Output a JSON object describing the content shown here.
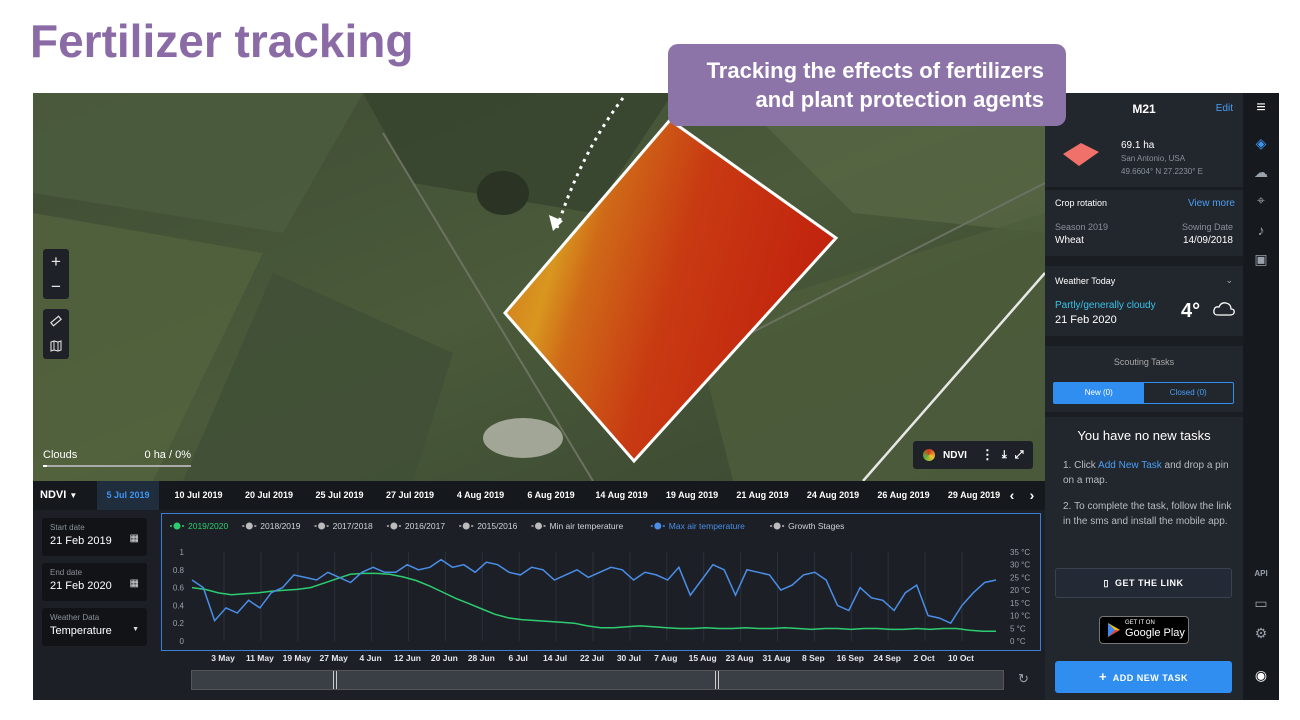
{
  "slide": {
    "title": "Fertilizer tracking",
    "callout_line1": "Tracking the effects of fertilizers",
    "callout_line2": "and plant protection agents"
  },
  "map": {
    "zoom_in": "+",
    "zoom_out": "−",
    "clouds_label": "Clouds",
    "clouds_value": "0 ha / 0%",
    "layer_label": "NDVI"
  },
  "field": {
    "name": "M21",
    "edit": "Edit",
    "area": "69.1 ha",
    "location": "San Antonio, USA",
    "coords": "49.6604° N 27.2230° E",
    "shape_color": "#f0706a"
  },
  "crop": {
    "title": "Crop rotation",
    "view_more": "View more",
    "season_label": "Season 2019",
    "season_value": "Wheat",
    "sowing_label": "Sowing Date",
    "sowing_value": "14/09/2018"
  },
  "weather": {
    "title": "Weather Today",
    "condition": "Partly/generally cloudy",
    "date": "21 Feb 2020",
    "temp": "4°"
  },
  "scouting": {
    "title": "Scouting Tasks",
    "tab_new": "New (0)",
    "tab_closed": "Closed (0)",
    "empty_title": "You have no new tasks",
    "step1_prefix": "Click ",
    "step1_link": "Add New Task",
    "step1_suffix": " and drop a pin on a map.",
    "step2": "To complete the task, follow the link in the sms and install the mobile app.",
    "get_link": "GET THE LINK",
    "gplay_small": "GET IT ON",
    "gplay_big": "Google Play",
    "add_task": "ADD NEW TASK"
  },
  "iconbar": {
    "api": "API"
  },
  "timeline": {
    "index": "NDVI",
    "dates": [
      "5 Jul 2019",
      "10 Jul 2019",
      "20 Jul 2019",
      "25 Jul 2019",
      "27 Jul 2019",
      "4 Aug 2019",
      "6 Aug 2019",
      "14 Aug 2019",
      "19 Aug 2019",
      "21 Aug 2019",
      "24 Aug 2019",
      "26 Aug 2019",
      "29 Aug 2019"
    ],
    "selected": 0
  },
  "filters": {
    "start_label": "Start date",
    "start_value": "21 Feb 2019",
    "end_label": "End date",
    "end_value": "21 Feb 2020",
    "weather_label": "Weather Data",
    "weather_value": "Temperature"
  },
  "chart_data": {
    "type": "line",
    "legend": [
      "2019/2020",
      "2018/2019",
      "2017/2018",
      "2016/2017",
      "2015/2016",
      "Min air temperature",
      "Max air temperature",
      "Growth Stages"
    ],
    "x_ticks": [
      "3 May",
      "11 May",
      "19 May",
      "27 May",
      "4 Jun",
      "12 Jun",
      "20 Jun",
      "28 Jun",
      "6 Jul",
      "14 Jul",
      "22 Jul",
      "30 Jul",
      "7 Aug",
      "15 Aug",
      "23 Aug",
      "31 Aug",
      "8 Sep",
      "16 Sep",
      "24 Sep",
      "2 Oct",
      "10 Oct"
    ],
    "y_left_ticks": [
      "0",
      "0.2",
      "0.4",
      "0.6",
      "0.8",
      "1"
    ],
    "y_right_ticks": [
      "0 °C",
      "5 °C",
      "10 °C",
      "15 °C",
      "20 °C",
      "25 °C",
      "30 °C",
      "35 °C"
    ],
    "ylim_left": [
      0,
      1
    ],
    "ylim_right": [
      0,
      35
    ],
    "series": [
      {
        "name": "2019/2020",
        "color": "#2ecc71",
        "axis": "left",
        "values": [
          0.6,
          0.58,
          0.54,
          0.52,
          0.53,
          0.54,
          0.56,
          0.57,
          0.58,
          0.6,
          0.65,
          0.7,
          0.75,
          0.76,
          0.76,
          0.75,
          0.72,
          0.68,
          0.62,
          0.55,
          0.48,
          0.42,
          0.36,
          0.3,
          0.26,
          0.24,
          0.23,
          0.22,
          0.21,
          0.2,
          0.17,
          0.15,
          0.15,
          0.16,
          0.17,
          0.16,
          0.15,
          0.14,
          0.14,
          0.15,
          0.14,
          0.14,
          0.15,
          0.14,
          0.14,
          0.15,
          0.14,
          0.13,
          0.14,
          0.14,
          0.13,
          0.14,
          0.14,
          0.13,
          0.13,
          0.14,
          0.13,
          0.14,
          0.14,
          0.12,
          0.11,
          0.11
        ]
      },
      {
        "name": "Max air temperature",
        "color": "#4a8ee8",
        "axis": "right",
        "values": [
          24,
          21,
          8,
          13,
          11,
          16,
          13,
          19,
          21,
          26,
          25,
          24,
          27,
          25,
          23,
          27,
          29,
          27,
          27,
          30,
          28,
          29,
          32,
          29,
          30,
          27,
          31,
          30,
          27,
          26,
          29,
          28,
          24,
          26,
          28,
          25,
          27,
          29,
          28,
          24,
          27,
          26,
          24,
          29,
          18,
          24,
          30,
          28,
          18,
          28,
          27,
          26,
          20,
          22,
          26,
          27,
          24,
          14,
          12,
          21,
          17,
          16,
          12,
          19,
          22,
          10,
          9,
          7,
          14,
          19,
          23,
          24
        ]
      }
    ]
  }
}
